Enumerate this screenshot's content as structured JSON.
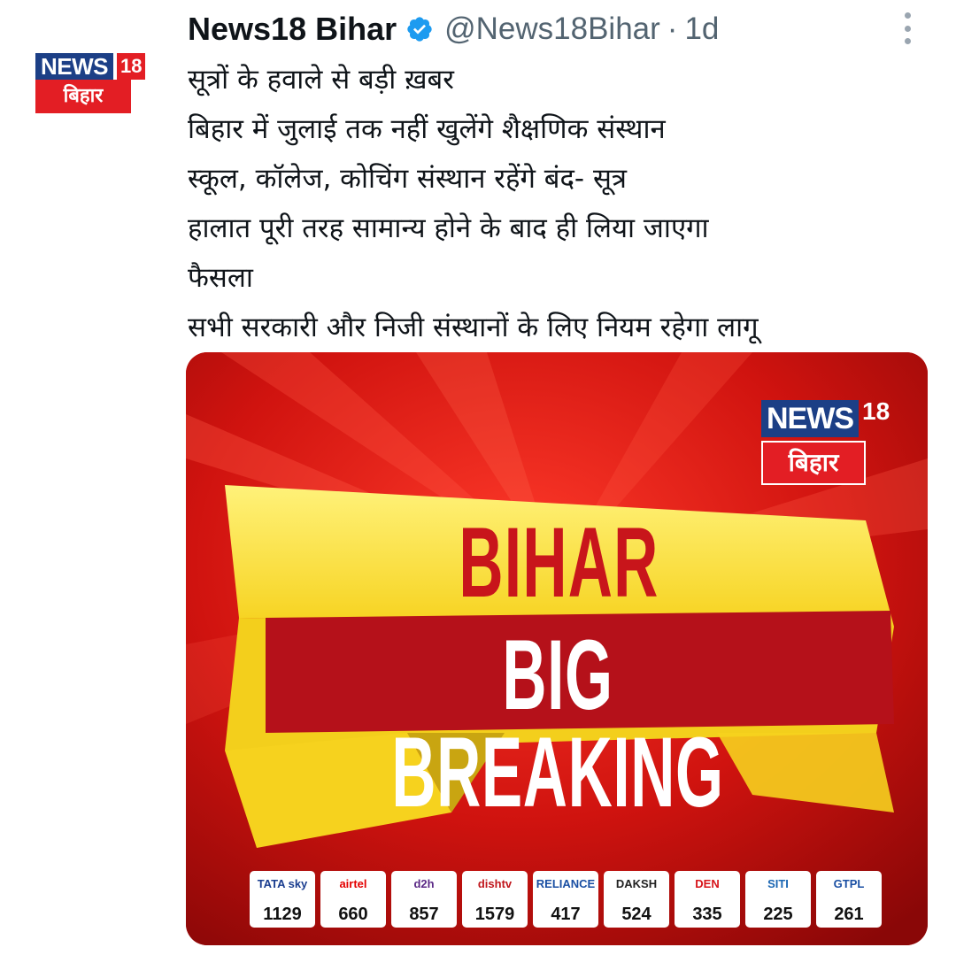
{
  "tweet": {
    "author_name": "News18 Bihar",
    "handle": "@News18Bihar",
    "separator": "·",
    "time": "1d",
    "verified": true,
    "avatar": {
      "logo_news": "NEWS",
      "logo_18": "18",
      "logo_bihar": "बिहार"
    },
    "text_lines": [
      "सूत्रों के हवाले से बड़ी ख़बर",
      "बिहार में जुलाई तक नहीं खुलेंगे शैक्षणिक संस्थान",
      "स्कूल, कॉलेज, कोचिंग संस्थान रहेंगे बंद- सूत्र",
      "हालात पूरी तरह सामान्य होने के बाद ही लिया जाएगा",
      "फैसला",
      "सभी सरकारी और निजी संस्थानों के लिए नियम रहेगा लागू"
    ]
  },
  "media": {
    "logo_news": "NEWS",
    "logo_18": "18",
    "logo_bihar": "बिहार",
    "headline_top": "BIHAR",
    "headline_bottom": "BIG BREAKING",
    "channels": [
      {
        "brand": "TATA sky",
        "number": "1129",
        "color": "#1a3d8f"
      },
      {
        "brand": "airtel",
        "number": "660",
        "color": "#e40000"
      },
      {
        "brand": "d2h",
        "number": "857",
        "color": "#5b2a86"
      },
      {
        "brand": "dishtv",
        "number": "1579",
        "color": "#c0161c"
      },
      {
        "brand": "RELIANCE",
        "number": "417",
        "color": "#1a4fa3"
      },
      {
        "brand": "DAKSH",
        "number": "524",
        "color": "#222222"
      },
      {
        "brand": "DEN",
        "number": "335",
        "color": "#d7141a"
      },
      {
        "brand": "SITI",
        "number": "225",
        "color": "#1a66b3"
      },
      {
        "brand": "GTPL",
        "number": "261",
        "color": "#1a4fa3"
      }
    ]
  },
  "colors": {
    "text_primary": "#0f1419",
    "text_secondary": "#536471",
    "verified_blue": "#1d9bf0",
    "news18_blue": "#1c3f86",
    "news18_red": "#e31e24",
    "banner_yellow": "#fbe83a"
  },
  "icons": {
    "verified": "verified-badge-icon",
    "more": "more-options-icon"
  }
}
